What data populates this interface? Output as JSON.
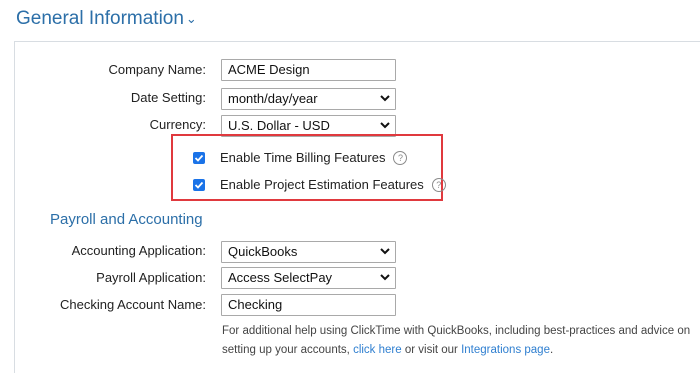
{
  "section": {
    "title": "General Information"
  },
  "fields": {
    "company_name": {
      "label": "Company Name:",
      "value": "ACME Design"
    },
    "date_setting": {
      "label": "Date Setting:",
      "value": "month/day/year"
    },
    "currency": {
      "label": "Currency:",
      "value": "U.S. Dollar - USD"
    }
  },
  "features": {
    "time_billing": {
      "label": "Enable Time Billing Features",
      "checked": true
    },
    "project_estimation": {
      "label": "Enable Project Estimation Features",
      "checked": true
    }
  },
  "payroll": {
    "title": "Payroll and Accounting",
    "accounting_app": {
      "label": "Accounting Application:",
      "value": "QuickBooks"
    },
    "payroll_app": {
      "label": "Payroll Application:",
      "value": "Access SelectPay"
    },
    "checking_account": {
      "label": "Checking Account Name:",
      "value": "Checking"
    },
    "help": {
      "text_before": "For additional help using ClickTime with QuickBooks, including best-practices and advice on setting up your accounts,",
      "link_click_here": "click here",
      "text_middle": "or visit our",
      "link_integrations": "Integrations page",
      "text_after": "."
    }
  },
  "colors": {
    "accent": "#2c6fa8",
    "checkbox": "#1a73e8",
    "highlight": "#e0393e",
    "link": "#2f7fd0"
  }
}
